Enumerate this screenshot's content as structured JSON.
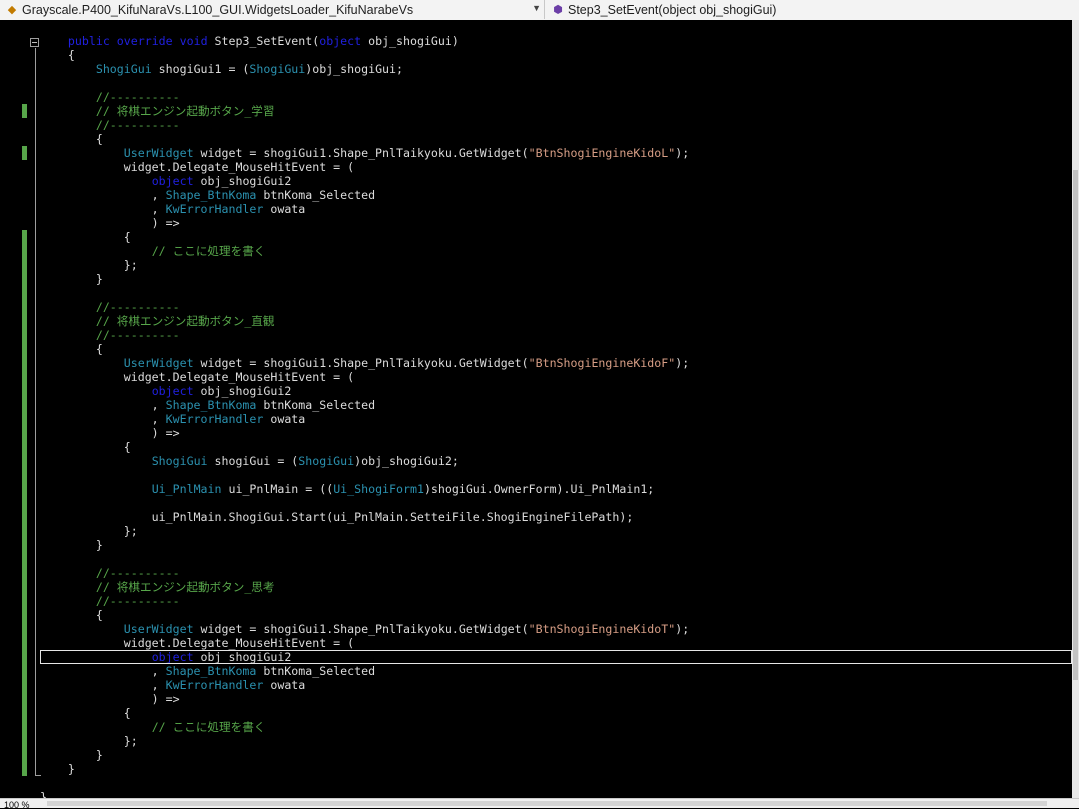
{
  "navbar": {
    "left_dropdown": {
      "icon": "class-icon",
      "text": "Grayscale.P400_KifuNaraVs.L100_GUI.WidgetsLoader_KifuNarabeVs"
    },
    "right_dropdown": {
      "icon": "method-icon",
      "text": "Step3_SetEvent(object obj_shogiGui)"
    }
  },
  "colors": {
    "keyword": "#2020e0",
    "type": "#2b91af",
    "comment": "#57a64a",
    "string": "#d69d85",
    "plain": "#dcdcdc",
    "background": "#000000"
  },
  "code": {
    "current_line_index": 44,
    "lines": [
      [
        [
          "    ",
          "pl"
        ],
        [
          "public",
          "kw"
        ],
        [
          " ",
          "pl"
        ],
        [
          "override",
          "kw"
        ],
        [
          " ",
          "pl"
        ],
        [
          "void",
          "kw"
        ],
        [
          " Step3_SetEvent(",
          "pl"
        ],
        [
          "object",
          "kw"
        ],
        [
          " obj_shogiGui)",
          "pl"
        ]
      ],
      [
        [
          "    {",
          "pl"
        ]
      ],
      [
        [
          "        ",
          "pl"
        ],
        [
          "ShogiGui",
          "ty"
        ],
        [
          " shogiGui1 = (",
          "pl"
        ],
        [
          "ShogiGui",
          "ty"
        ],
        [
          ")obj_shogiGui;",
          "pl"
        ]
      ],
      [
        [
          "",
          "pl"
        ]
      ],
      [
        [
          "        ",
          "pl"
        ],
        [
          "//----------",
          "cm"
        ]
      ],
      [
        [
          "        ",
          "pl"
        ],
        [
          "// 将棋エンジン起動ボタン_学習",
          "cm"
        ]
      ],
      [
        [
          "        ",
          "pl"
        ],
        [
          "//----------",
          "cm"
        ]
      ],
      [
        [
          "        {",
          "pl"
        ]
      ],
      [
        [
          "            ",
          "pl"
        ],
        [
          "UserWidget",
          "ty"
        ],
        [
          " widget = shogiGui1.Shape_PnlTaikyoku.GetWidget(",
          "pl"
        ],
        [
          "\"BtnShogiEngineKidoL\"",
          "st"
        ],
        [
          ");",
          "pl"
        ]
      ],
      [
        [
          "            widget.Delegate_MouseHitEvent = (",
          "pl"
        ]
      ],
      [
        [
          "                ",
          "pl"
        ],
        [
          "object",
          "kw"
        ],
        [
          " obj_shogiGui2",
          "pl"
        ]
      ],
      [
        [
          "                , ",
          "pl"
        ],
        [
          "Shape_BtnKoma",
          "ty"
        ],
        [
          " btnKoma_Selected",
          "pl"
        ]
      ],
      [
        [
          "                , ",
          "pl"
        ],
        [
          "KwErrorHandler",
          "ty"
        ],
        [
          " owata",
          "pl"
        ]
      ],
      [
        [
          "                ) =>",
          "pl"
        ]
      ],
      [
        [
          "            {",
          "pl"
        ]
      ],
      [
        [
          "                ",
          "pl"
        ],
        [
          "// ここに処理を書く",
          "cm"
        ]
      ],
      [
        [
          "            };",
          "pl"
        ]
      ],
      [
        [
          "        }",
          "pl"
        ]
      ],
      [
        [
          "",
          "pl"
        ]
      ],
      [
        [
          "        ",
          "pl"
        ],
        [
          "//----------",
          "cm"
        ]
      ],
      [
        [
          "        ",
          "pl"
        ],
        [
          "// 将棋エンジン起動ボタン_直観",
          "cm"
        ]
      ],
      [
        [
          "        ",
          "pl"
        ],
        [
          "//----------",
          "cm"
        ]
      ],
      [
        [
          "        {",
          "pl"
        ]
      ],
      [
        [
          "            ",
          "pl"
        ],
        [
          "UserWidget",
          "ty"
        ],
        [
          " widget = shogiGui1.Shape_PnlTaikyoku.GetWidget(",
          "pl"
        ],
        [
          "\"BtnShogiEngineKidoF\"",
          "st"
        ],
        [
          ");",
          "pl"
        ]
      ],
      [
        [
          "            widget.Delegate_MouseHitEvent = (",
          "pl"
        ]
      ],
      [
        [
          "                ",
          "pl"
        ],
        [
          "object",
          "kw"
        ],
        [
          " obj_shogiGui2",
          "pl"
        ]
      ],
      [
        [
          "                , ",
          "pl"
        ],
        [
          "Shape_BtnKoma",
          "ty"
        ],
        [
          " btnKoma_Selected",
          "pl"
        ]
      ],
      [
        [
          "                , ",
          "pl"
        ],
        [
          "KwErrorHandler",
          "ty"
        ],
        [
          " owata",
          "pl"
        ]
      ],
      [
        [
          "                ) =>",
          "pl"
        ]
      ],
      [
        [
          "            {",
          "pl"
        ]
      ],
      [
        [
          "                ",
          "pl"
        ],
        [
          "ShogiGui",
          "ty"
        ],
        [
          " shogiGui = (",
          "pl"
        ],
        [
          "ShogiGui",
          "ty"
        ],
        [
          ")obj_shogiGui2;",
          "pl"
        ]
      ],
      [
        [
          "",
          "pl"
        ]
      ],
      [
        [
          "                ",
          "pl"
        ],
        [
          "Ui_PnlMain",
          "ty"
        ],
        [
          " ui_PnlMain = ((",
          "pl"
        ],
        [
          "Ui_ShogiForm1",
          "ty"
        ],
        [
          ")shogiGui.OwnerForm).Ui_PnlMain1;",
          "pl"
        ]
      ],
      [
        [
          "",
          "pl"
        ]
      ],
      [
        [
          "                ui_PnlMain.ShogiGui.Start(ui_PnlMain.SetteiFile.ShogiEngineFilePath);",
          "pl"
        ]
      ],
      [
        [
          "            };",
          "pl"
        ]
      ],
      [
        [
          "        }",
          "pl"
        ]
      ],
      [
        [
          "",
          "pl"
        ]
      ],
      [
        [
          "        ",
          "pl"
        ],
        [
          "//----------",
          "cm"
        ]
      ],
      [
        [
          "        ",
          "pl"
        ],
        [
          "// 将棋エンジン起動ボタン_思考",
          "cm"
        ]
      ],
      [
        [
          "        ",
          "pl"
        ],
        [
          "//----------",
          "cm"
        ]
      ],
      [
        [
          "        {",
          "pl"
        ]
      ],
      [
        [
          "            ",
          "pl"
        ],
        [
          "UserWidget",
          "ty"
        ],
        [
          " widget = shogiGui1.Shape_PnlTaikyoku.GetWidget(",
          "pl"
        ],
        [
          "\"BtnShogiEngineKidoT\"",
          "st"
        ],
        [
          ");",
          "pl"
        ]
      ],
      [
        [
          "            widget.Delegate_MouseHitEvent = (",
          "pl"
        ]
      ],
      [
        [
          "                ",
          "pl"
        ],
        [
          "object",
          "kw"
        ],
        [
          " obj_shogiGui2",
          "pl"
        ]
      ],
      [
        [
          "                , ",
          "pl"
        ],
        [
          "Shape_BtnKoma",
          "ty"
        ],
        [
          " btnKoma_Selected",
          "pl"
        ]
      ],
      [
        [
          "                , ",
          "pl"
        ],
        [
          "KwErrorHandler",
          "ty"
        ],
        [
          " owata",
          "pl"
        ]
      ],
      [
        [
          "                ) =>",
          "pl"
        ]
      ],
      [
        [
          "            {",
          "pl"
        ]
      ],
      [
        [
          "                ",
          "pl"
        ],
        [
          "// ここに処理を書く",
          "cm"
        ]
      ],
      [
        [
          "            };",
          "pl"
        ]
      ],
      [
        [
          "        }",
          "pl"
        ]
      ],
      [
        [
          "    }",
          "pl"
        ]
      ],
      [
        [
          "",
          "pl"
        ]
      ],
      [
        [
          "}",
          "pl"
        ]
      ]
    ]
  },
  "statusbar": {
    "zoom": "100 %"
  }
}
